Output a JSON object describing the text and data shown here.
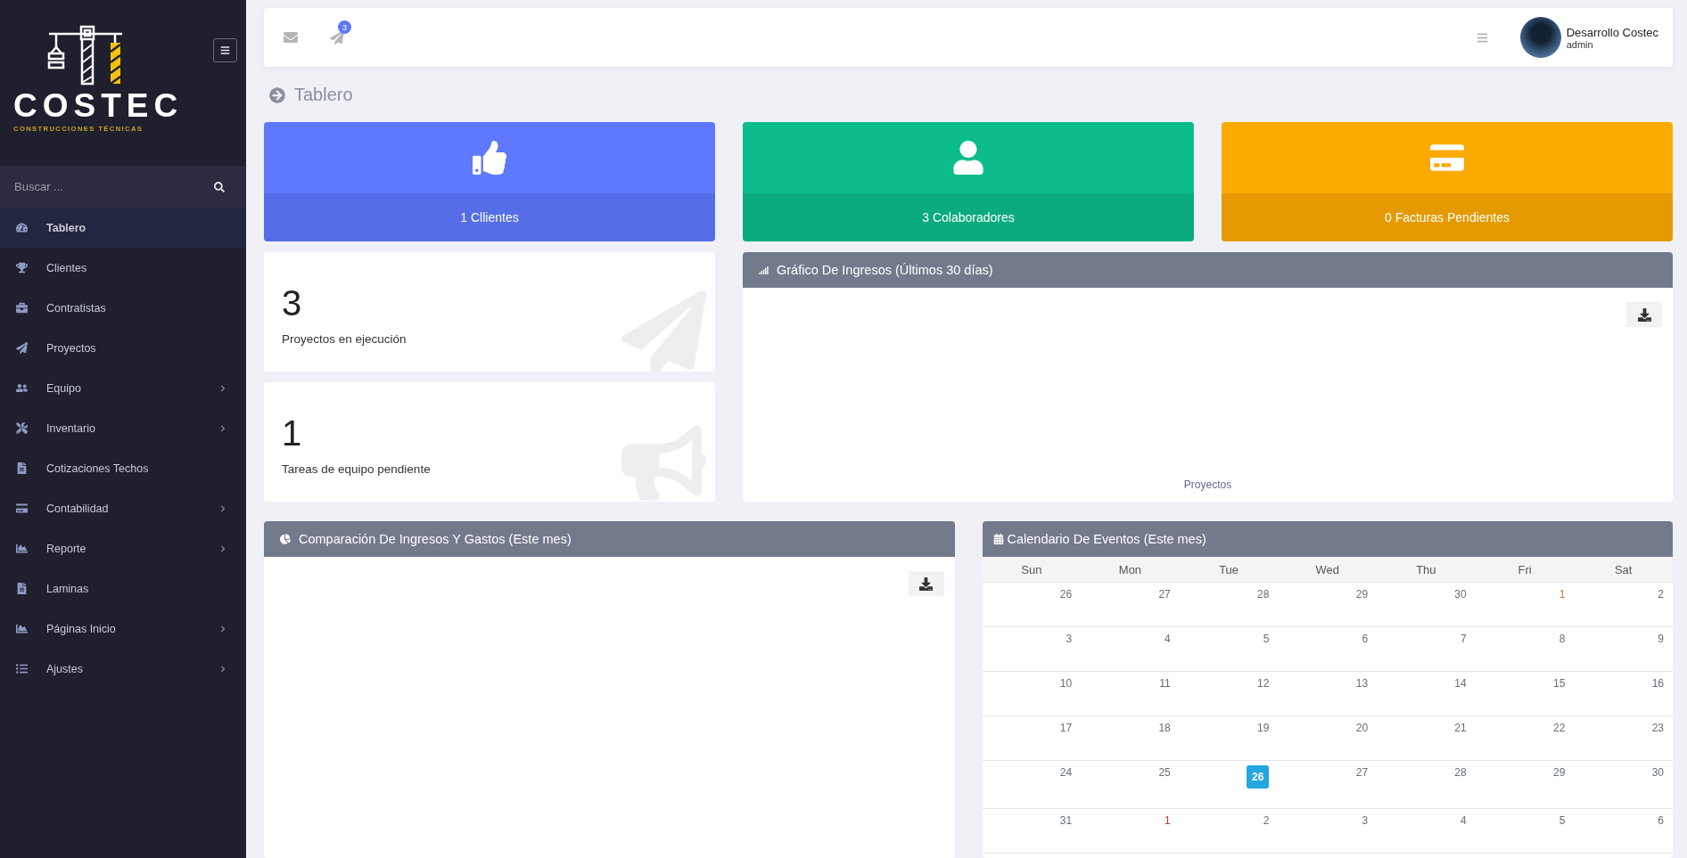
{
  "sidebar": {
    "logo": {
      "name": "COSTEC",
      "tagline": "CONSTRUCCIONES TÉCNICAS"
    },
    "search": {
      "placeholder": "Buscar ..."
    },
    "items": [
      {
        "label": "Tablero",
        "selected": true,
        "has_submenu": false
      },
      {
        "label": "Clientes",
        "selected": false,
        "has_submenu": false
      },
      {
        "label": "Contratistas",
        "selected": false,
        "has_submenu": false
      },
      {
        "label": "Proyectos",
        "selected": false,
        "has_submenu": false
      },
      {
        "label": "Equipo",
        "selected": false,
        "has_submenu": true
      },
      {
        "label": "Inventario",
        "selected": false,
        "has_submenu": true
      },
      {
        "label": "Cotizaciones Techos",
        "selected": false,
        "has_submenu": false
      },
      {
        "label": "Contabilidad",
        "selected": false,
        "has_submenu": true
      },
      {
        "label": "Reporte",
        "selected": false,
        "has_submenu": true
      },
      {
        "label": "Laminas",
        "selected": false,
        "has_submenu": false
      },
      {
        "label": "Páginas Inicio",
        "selected": false,
        "has_submenu": true
      },
      {
        "label": "Ajustes",
        "selected": false,
        "has_submenu": true
      }
    ]
  },
  "topbar": {
    "notification_count": "3",
    "user": {
      "name": "Desarrollo Costec",
      "role": "admin"
    }
  },
  "page_title": "Tablero",
  "stat_cards": [
    {
      "label": "1 Cllientes",
      "color": "#5e78fe"
    },
    {
      "label": "3 Colaboradores",
      "color": "#0cbc8b"
    },
    {
      "label": "0 Facturas Pendientes",
      "color": "#fbaa00"
    }
  ],
  "counters": [
    {
      "value": "3",
      "label": "Proyectos en ejecución"
    },
    {
      "value": "1",
      "label": "Tareas de equipo pendiente"
    }
  ],
  "income_chart": {
    "title": "Gráfico De Ingresos (Últimos 30 días)",
    "axis_label": "Proyectos"
  },
  "comparison_chart": {
    "title": "Comparación De Ingresos Y Gastos (Este mes)"
  },
  "calendar": {
    "title": "Calendario De Eventos (Este mes)",
    "weekdays": [
      "Sun",
      "Mon",
      "Tue",
      "Wed",
      "Thu",
      "Fri",
      "Sat"
    ],
    "weeks": [
      [
        {
          "day": "26",
          "today": false
        },
        {
          "day": "27",
          "today": false
        },
        {
          "day": "28",
          "today": false
        },
        {
          "day": "29",
          "today": false
        },
        {
          "day": "30",
          "today": false
        },
        {
          "day": "1",
          "today": false,
          "color": "#c8793a"
        },
        {
          "day": "2",
          "today": false
        }
      ],
      [
        {
          "day": "3",
          "today": false
        },
        {
          "day": "4",
          "today": false
        },
        {
          "day": "5",
          "today": false
        },
        {
          "day": "6",
          "today": false
        },
        {
          "day": "7",
          "today": false
        },
        {
          "day": "8",
          "today": false
        },
        {
          "day": "9",
          "today": false
        }
      ],
      [
        {
          "day": "10",
          "today": false
        },
        {
          "day": "11",
          "today": false
        },
        {
          "day": "12",
          "today": false
        },
        {
          "day": "13",
          "today": false
        },
        {
          "day": "14",
          "today": false
        },
        {
          "day": "15",
          "today": false
        },
        {
          "day": "16",
          "today": false
        }
      ],
      [
        {
          "day": "17",
          "today": false
        },
        {
          "day": "18",
          "today": false
        },
        {
          "day": "19",
          "today": false
        },
        {
          "day": "20",
          "today": false
        },
        {
          "day": "21",
          "today": false
        },
        {
          "day": "22",
          "today": false
        },
        {
          "day": "23",
          "today": false
        }
      ],
      [
        {
          "day": "24",
          "today": false
        },
        {
          "day": "25",
          "today": false
        },
        {
          "day": "26",
          "today": true
        },
        {
          "day": "27",
          "today": false
        },
        {
          "day": "28",
          "today": false
        },
        {
          "day": "29",
          "today": false
        },
        {
          "day": "30",
          "today": false
        }
      ],
      [
        {
          "day": "31",
          "today": false
        },
        {
          "day": "1",
          "today": false,
          "color": "#c0392b"
        },
        {
          "day": "2",
          "today": false
        },
        {
          "day": "3",
          "today": false
        },
        {
          "day": "4",
          "today": false
        },
        {
          "day": "5",
          "today": false
        },
        {
          "day": "6",
          "today": false
        }
      ]
    ]
  }
}
